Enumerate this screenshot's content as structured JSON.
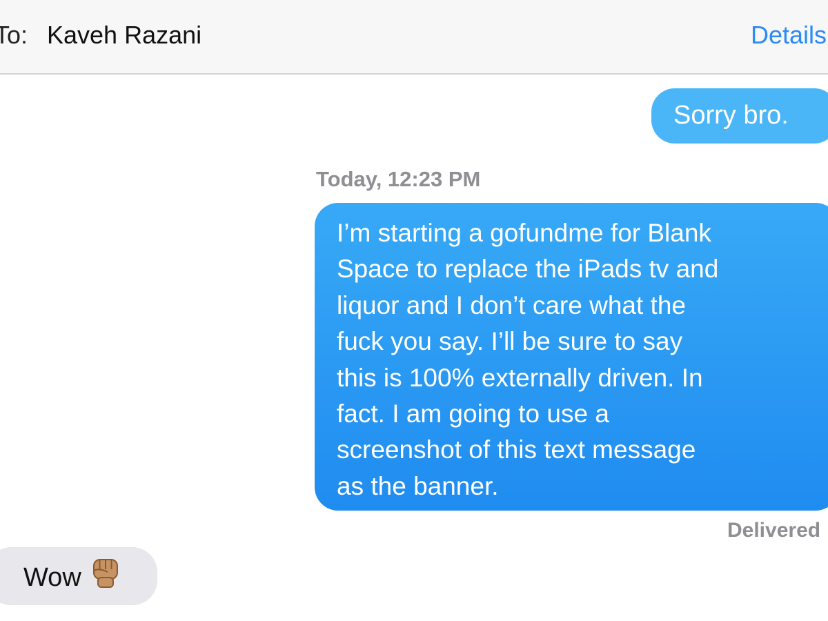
{
  "header": {
    "to_label": "To:",
    "recipient": "Kaveh Razani",
    "details_label": "Details"
  },
  "messages": [
    {
      "direction": "outgoing",
      "text": "Sorry bro."
    },
    {
      "direction": "outgoing",
      "timestamp": "Today, 12:23 PM",
      "text": "I’m starting a gofundme for Blank\nSpace to replace the iPads tv and\nliquor and I don’t care what the\nfuck you say. I’ll be sure to say\nthis is 100% externally driven. In\nfact. I am going to use a\nscreenshot of this text message\nas the banner.",
      "status": "Delivered"
    },
    {
      "direction": "incoming",
      "text": "Wow",
      "emoji_icon": "raised-fist-medium-skin-tone-icon"
    }
  ],
  "colors": {
    "outgoing_bubble_light": "#4ab6f7",
    "outgoing_bubble_dark": "#1f8cf0",
    "incoming_bubble": "#e7e7ec",
    "link": "#2a8af6",
    "meta_text": "#8e8e93"
  }
}
